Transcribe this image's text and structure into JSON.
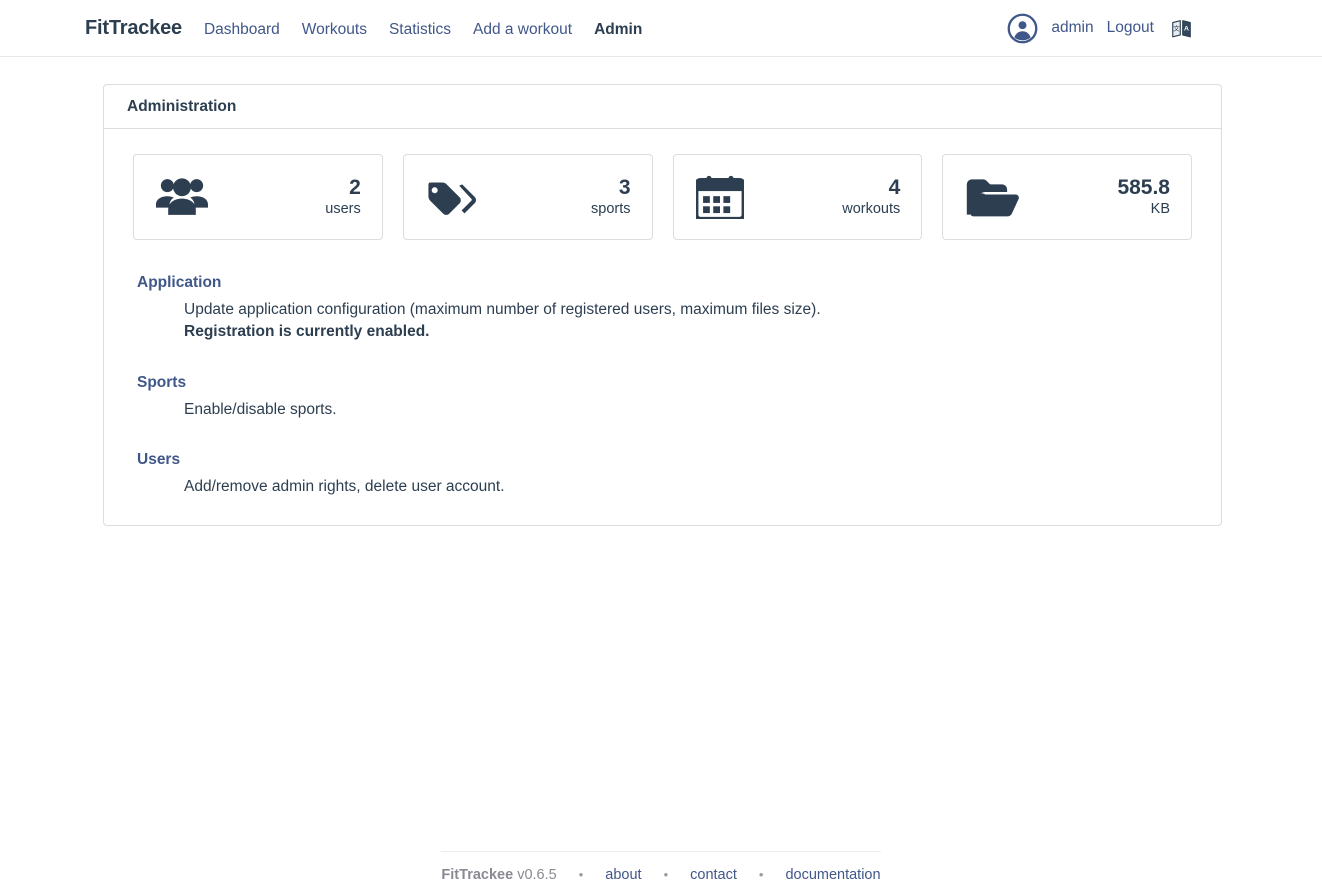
{
  "header": {
    "brand": "FitTrackee",
    "nav": [
      {
        "label": "Dashboard",
        "active": false
      },
      {
        "label": "Workouts",
        "active": false
      },
      {
        "label": "Statistics",
        "active": false
      },
      {
        "label": "Add a workout",
        "active": false
      },
      {
        "label": "Admin",
        "active": true
      }
    ],
    "avatar_icon": "circle-user-icon",
    "username": "admin",
    "logout_label": "Logout",
    "language_icon": "language-icon"
  },
  "main": {
    "card_title": "Administration",
    "stats": [
      {
        "icon": "users-icon",
        "value": "2",
        "label": "users"
      },
      {
        "icon": "tags-icon",
        "value": "3",
        "label": "sports"
      },
      {
        "icon": "calendar-icon",
        "value": "4",
        "label": "workouts"
      },
      {
        "icon": "folder-open-icon",
        "value": "585.8",
        "label": "KB"
      }
    ],
    "sections": [
      {
        "title": "Application",
        "description": "Update application configuration (maximum number of registered users, maximum files size).",
        "note": "Registration is currently enabled."
      },
      {
        "title": "Sports",
        "description": "Enable/disable sports.",
        "note": ""
      },
      {
        "title": "Users",
        "description": "Add/remove admin rights, delete user account.",
        "note": ""
      }
    ]
  },
  "footer": {
    "brand": "FitTrackee",
    "version": "v0.6.5",
    "separator": "•",
    "links": [
      {
        "label": "about"
      },
      {
        "label": "contact"
      },
      {
        "label": "documentation"
      }
    ]
  },
  "colors": {
    "text_dark": "#2c3e50",
    "link_blue": "#40578a",
    "border_grey": "#dcdce1",
    "muted_grey": "#8a8a93"
  }
}
